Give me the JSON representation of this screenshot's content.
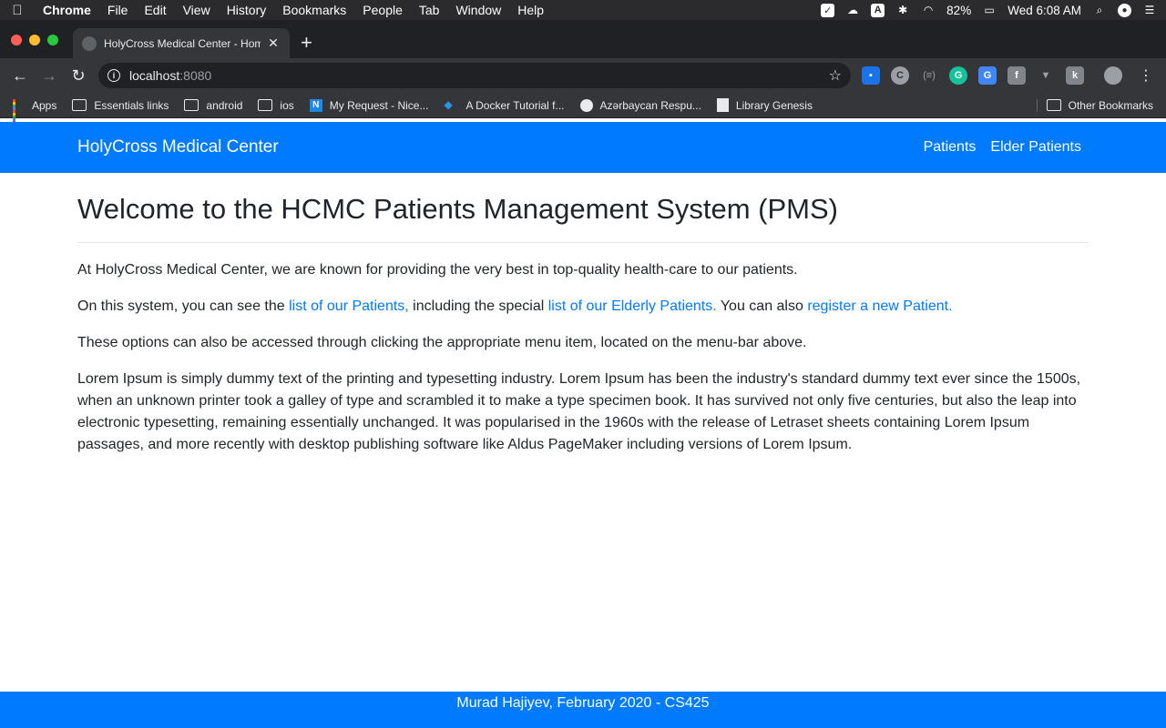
{
  "menubar": {
    "app": "Chrome",
    "items": [
      "File",
      "Edit",
      "View",
      "History",
      "Bookmarks",
      "People",
      "Tab",
      "Window",
      "Help"
    ],
    "battery": "82%",
    "clock": "Wed 6:08 AM"
  },
  "browser": {
    "tab_title": "HolyCross Medical Center - Home",
    "url_host": "localhost",
    "url_port": ":8080"
  },
  "bookmarks": {
    "items": [
      "Apps",
      "Essentials links",
      "android",
      "ios",
      "My Request - Nice...",
      "A Docker Tutorial f...",
      "Azərbaycan Respu...",
      "Library Genesis"
    ],
    "other": "Other Bookmarks"
  },
  "site": {
    "brand": "HolyCross Medical Center",
    "nav": [
      "Patients",
      "Elder Patients"
    ],
    "heading": "Welcome to the HCMC Patients Management System (PMS)",
    "p1": "At HolyCross Medical Center, we are known for providing the very best in top-quality health-care to our patients.",
    "p2_a": "On this system, you can see the ",
    "p2_link1": "list of our Patients,",
    "p2_b": " including the special ",
    "p2_link2": "list of our Elderly Patients.",
    "p2_c": " You can also ",
    "p2_link3": "register a new Patient.",
    "p3": "These options can also be accessed through clicking the appropriate menu item, located on the menu-bar above.",
    "p4": "Lorem Ipsum is simply dummy text of the printing and typesetting industry. Lorem Ipsum has been the industry's standard dummy text ever since the 1500s, when an unknown printer took a galley of type and scrambled it to make a type specimen book. It has survived not only five centuries, but also the leap into electronic typesetting, remaining essentially unchanged. It was popularised in the 1960s with the release of Letraset sheets containing Lorem Ipsum passages, and more recently with desktop publishing software like Aldus PageMaker including versions of Lorem Ipsum.",
    "footer": "Murad Hajiyev, February 2020 - CS425"
  },
  "colors": {
    "primary": "#007bff",
    "text": "#212529"
  }
}
